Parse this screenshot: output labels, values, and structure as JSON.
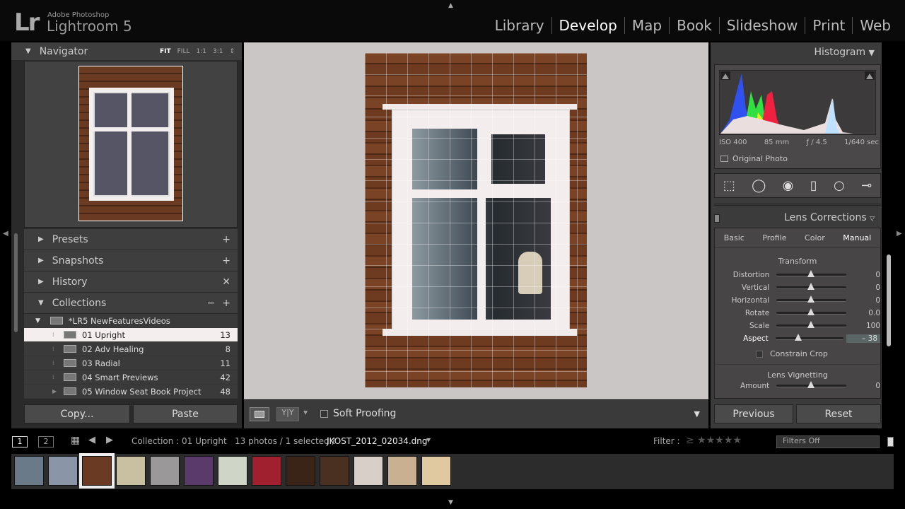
{
  "app": {
    "logo": "Lr",
    "vendor": "Adobe Photoshop",
    "name": "Lightroom 5"
  },
  "modules": [
    {
      "label": "Library"
    },
    {
      "label": "Develop",
      "active": true
    },
    {
      "label": "Map"
    },
    {
      "label": "Book"
    },
    {
      "label": "Slideshow"
    },
    {
      "label": "Print"
    },
    {
      "label": "Web"
    }
  ],
  "left": {
    "navigator": {
      "title": "Navigator",
      "zoom": [
        "FIT",
        "FILL",
        "1:1",
        "3:1"
      ]
    },
    "presets": "Presets",
    "snapshots": "Snapshots",
    "history": "History",
    "collections": "Collections",
    "collection_set": "*LR5 NewFeaturesVideos",
    "items": [
      {
        "name": "01 Upright",
        "count": "13",
        "selected": true
      },
      {
        "name": "02 Adv Healing",
        "count": "8"
      },
      {
        "name": "03 Radial",
        "count": "11"
      },
      {
        "name": "04 Smart Previews",
        "count": "42"
      },
      {
        "name": "05 Window Seat Book Project",
        "count": "48"
      }
    ],
    "copy": "Copy...",
    "paste": "Paste"
  },
  "toolbar": {
    "soft_proofing": "Soft Proofing"
  },
  "right": {
    "histogram": {
      "title": "Histogram",
      "iso": "ISO 400",
      "focal": "85 mm",
      "aperture": "ƒ / 4.5",
      "shutter": "1/640 sec",
      "original_photo": "Original Photo"
    },
    "lens": {
      "title": "Lens Corrections",
      "tabs": [
        "Basic",
        "Profile",
        "Color",
        "Manual"
      ],
      "active_tab": "Manual",
      "transform": "Transform",
      "sliders": [
        {
          "label": "Distortion",
          "value": "0",
          "pos": 0.5
        },
        {
          "label": "Vertical",
          "value": "0",
          "pos": 0.5
        },
        {
          "label": "Horizontal",
          "value": "0",
          "pos": 0.5
        },
        {
          "label": "Rotate",
          "value": "0.0",
          "pos": 0.5
        },
        {
          "label": "Scale",
          "value": "100",
          "pos": 0.5
        },
        {
          "label": "Aspect",
          "value": "– 38",
          "pos": 0.33
        }
      ],
      "constrain_crop": "Constrain Crop",
      "vignetting": "Lens Vignetting",
      "amount": {
        "label": "Amount",
        "value": "0",
        "pos": 0.5
      }
    },
    "previous": "Previous",
    "reset": "Reset"
  },
  "filmstrip": {
    "pages": [
      "1",
      "2"
    ],
    "source": "Collection : 01 Upright",
    "count": "13 photos / 1 selected /",
    "filename": "JKOST_2012_02034.dng",
    "filter_label": "Filter :",
    "filter_value": "Filters Off",
    "thumbs": [
      "#6a7a88",
      "#8a95a8",
      "#6b3a22",
      "#c8c0a0",
      "#9a9898",
      "#5a3a6a",
      "#cfd6c8",
      "#a02030",
      "#3a2418",
      "#4a3020",
      "#d8d0c8",
      "#c8b090",
      "#e0c8a0"
    ]
  }
}
